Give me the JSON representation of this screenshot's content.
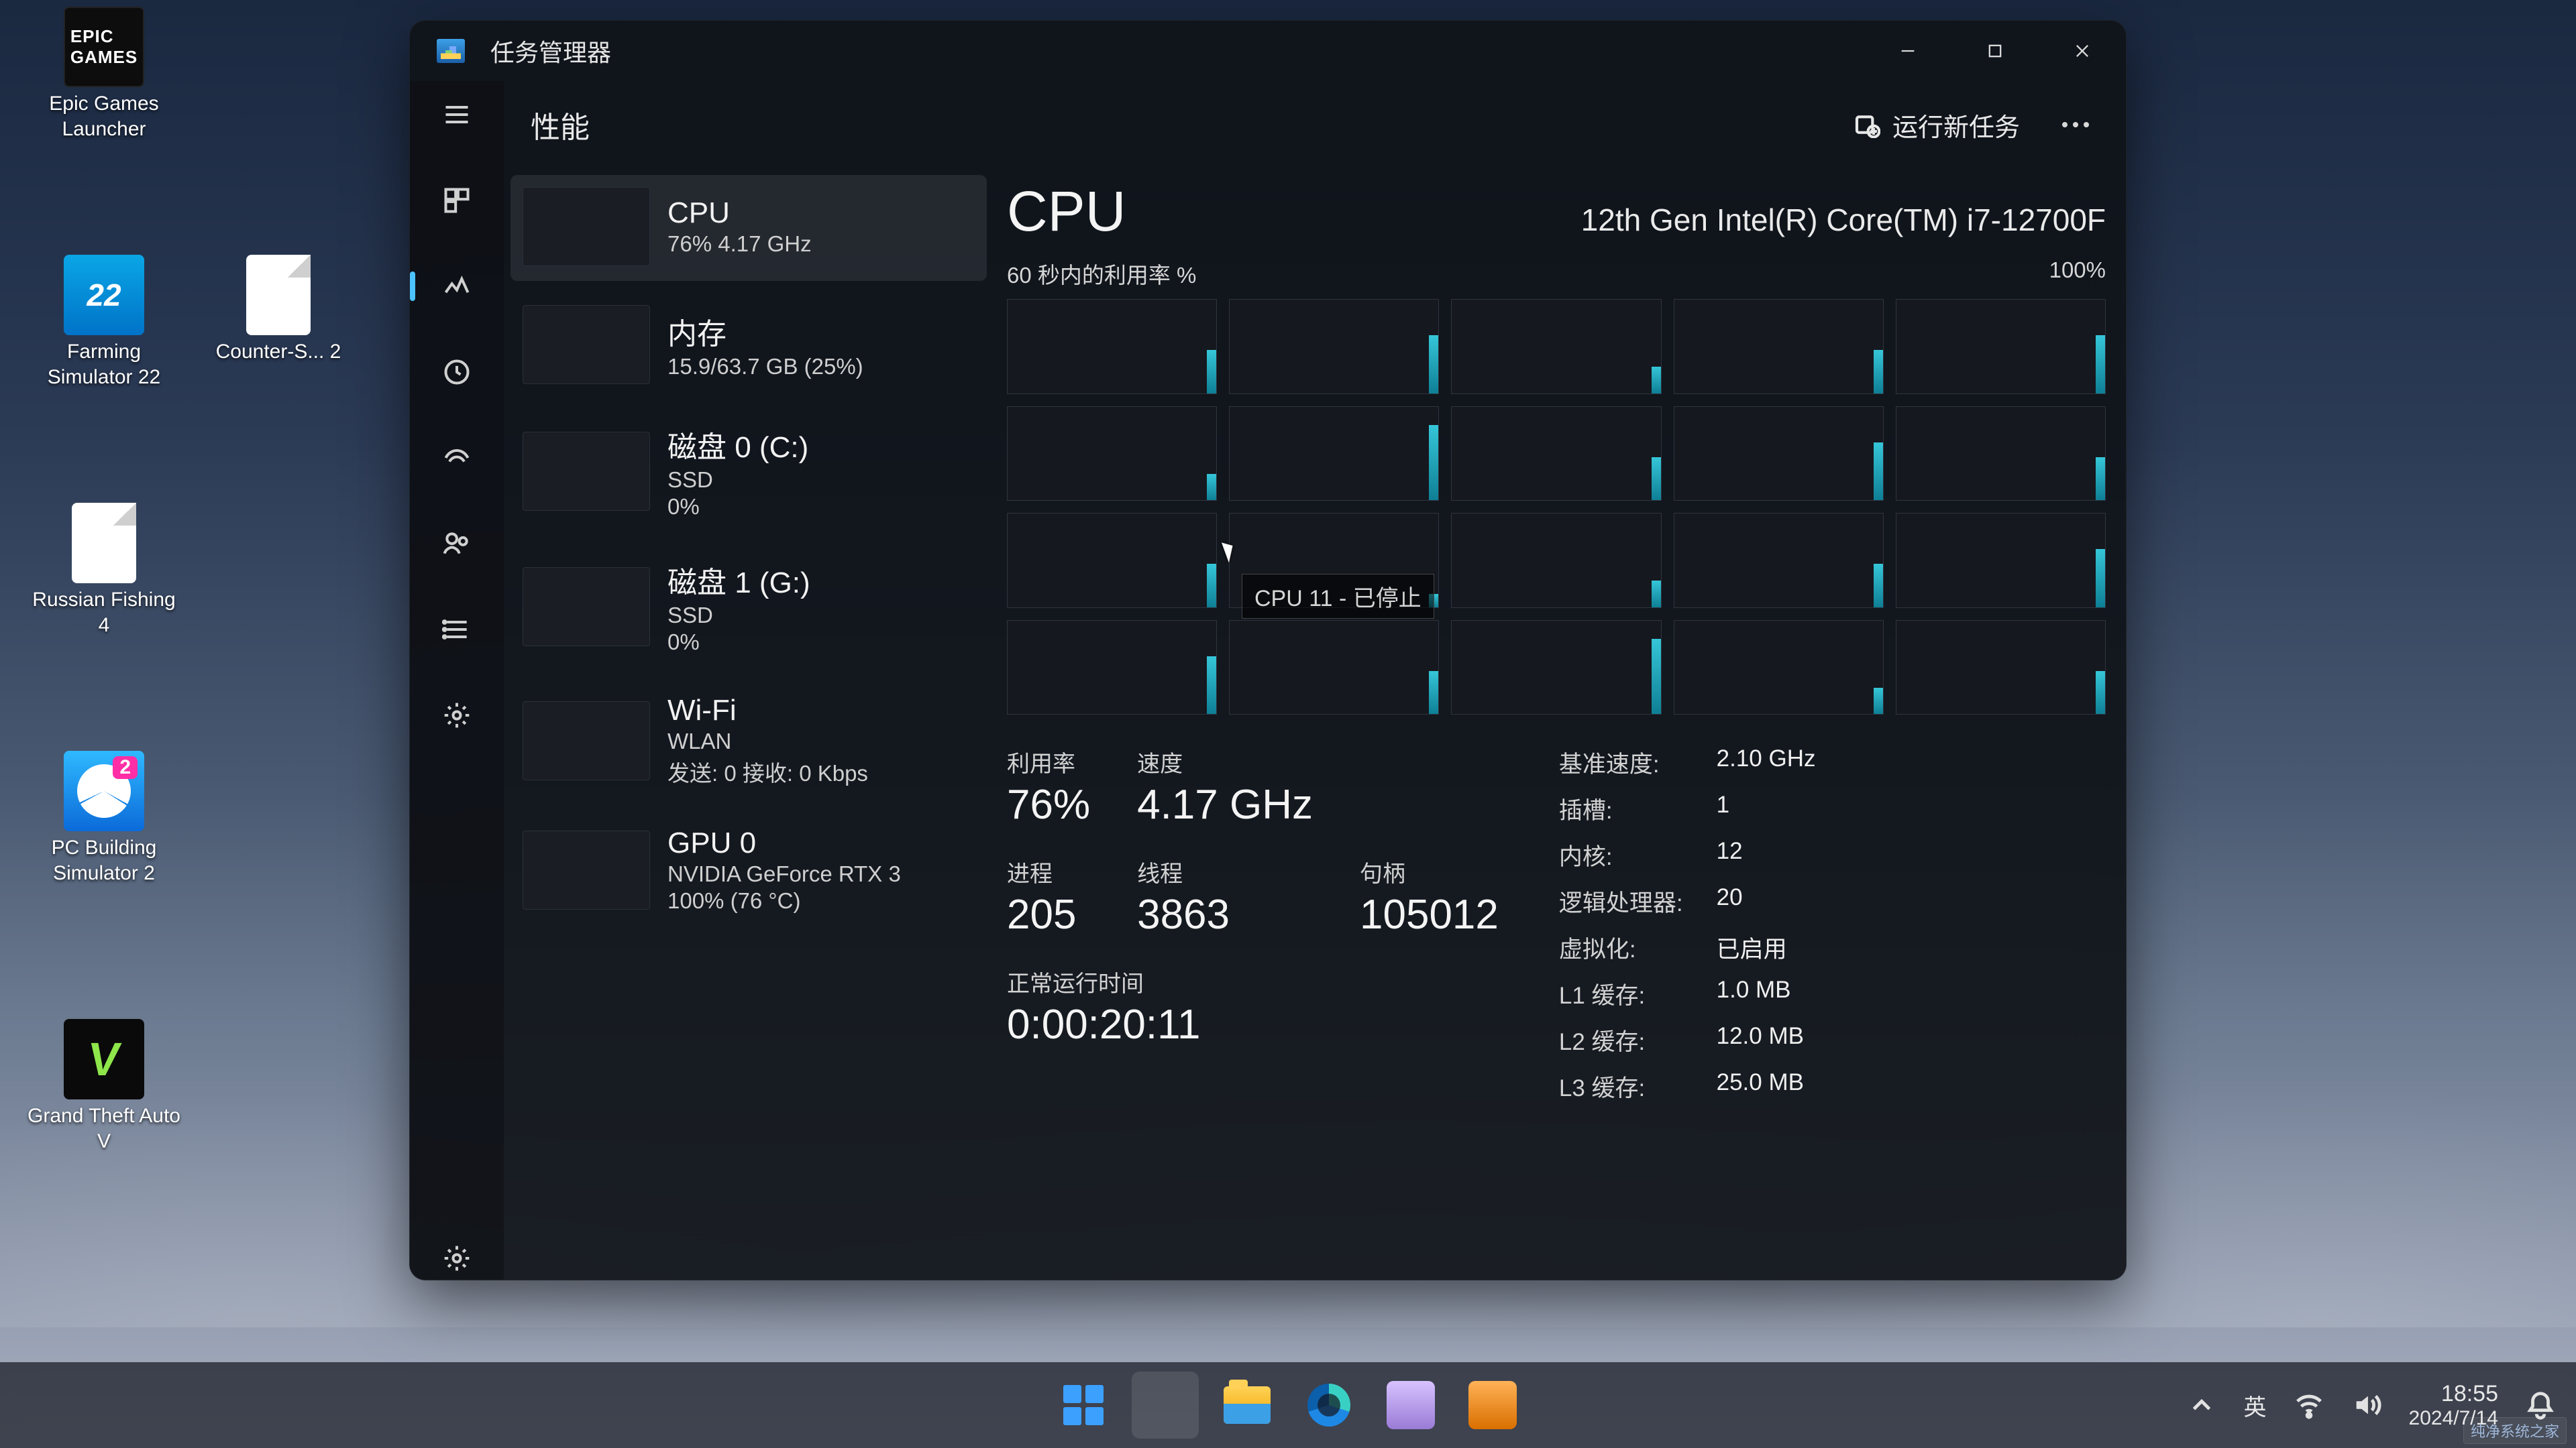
{
  "desktop": {
    "icons": [
      {
        "label": "Epic Games Launcher"
      },
      {
        "label": "Farming Simulator 22"
      },
      {
        "label": "Counter-S... 2"
      },
      {
        "label": "Russian Fishing 4"
      },
      {
        "label": "PC Building Simulator 2"
      },
      {
        "label": "Grand Theft Auto V"
      }
    ]
  },
  "window": {
    "title": "任务管理器",
    "section": "性能",
    "run_new_task": "运行新任务"
  },
  "sidebar": {
    "items": [
      {
        "title": "CPU",
        "line2": "76%  4.17 GHz",
        "line3": ""
      },
      {
        "title": "内存",
        "line2": "15.9/63.7 GB (25%)",
        "line3": ""
      },
      {
        "title": "磁盘 0 (C:)",
        "line2": "SSD",
        "line3": "0%"
      },
      {
        "title": "磁盘 1 (G:)",
        "line2": "SSD",
        "line3": "0%"
      },
      {
        "title": "Wi-Fi",
        "line2": "WLAN",
        "line3": "发送: 0  接收: 0 Kbps"
      },
      {
        "title": "GPU 0",
        "line2": "NVIDIA GeForce RTX 3",
        "line3": "100% (76 °C)"
      }
    ]
  },
  "detail": {
    "heading": "CPU",
    "model": "12th Gen Intel(R) Core(TM) i7-12700F",
    "chart_left_label": "60 秒内的利用率 %",
    "chart_right_label": "100%",
    "tooltip": "CPU 11 - 已停止",
    "stats": {
      "util_label": "利用率",
      "util": "76%",
      "speed_label": "速度",
      "speed": "4.17 GHz",
      "proc_label": "进程",
      "proc": "205",
      "thread_label": "线程",
      "thread": "3863",
      "handle_label": "句柄",
      "handle": "105012",
      "uptime_label": "正常运行时间",
      "uptime": "0:00:20:11"
    },
    "specs": {
      "base_k": "基准速度:",
      "base_v": "2.10 GHz",
      "sockets_k": "插槽:",
      "sockets_v": "1",
      "cores_k": "内核:",
      "cores_v": "12",
      "lp_k": "逻辑处理器:",
      "lp_v": "20",
      "virt_k": "虚拟化:",
      "virt_v": "已启用",
      "l1_k": "L1 缓存:",
      "l1_v": "1.0 MB",
      "l2_k": "L2 缓存:",
      "l2_v": "12.0 MB",
      "l3_k": "L3 缓存:",
      "l3_v": "25.0 MB"
    }
  },
  "taskbar": {
    "ime": "英",
    "time": "18:55",
    "date": "2024/7/14"
  },
  "watermark": "纯净系统之家"
}
